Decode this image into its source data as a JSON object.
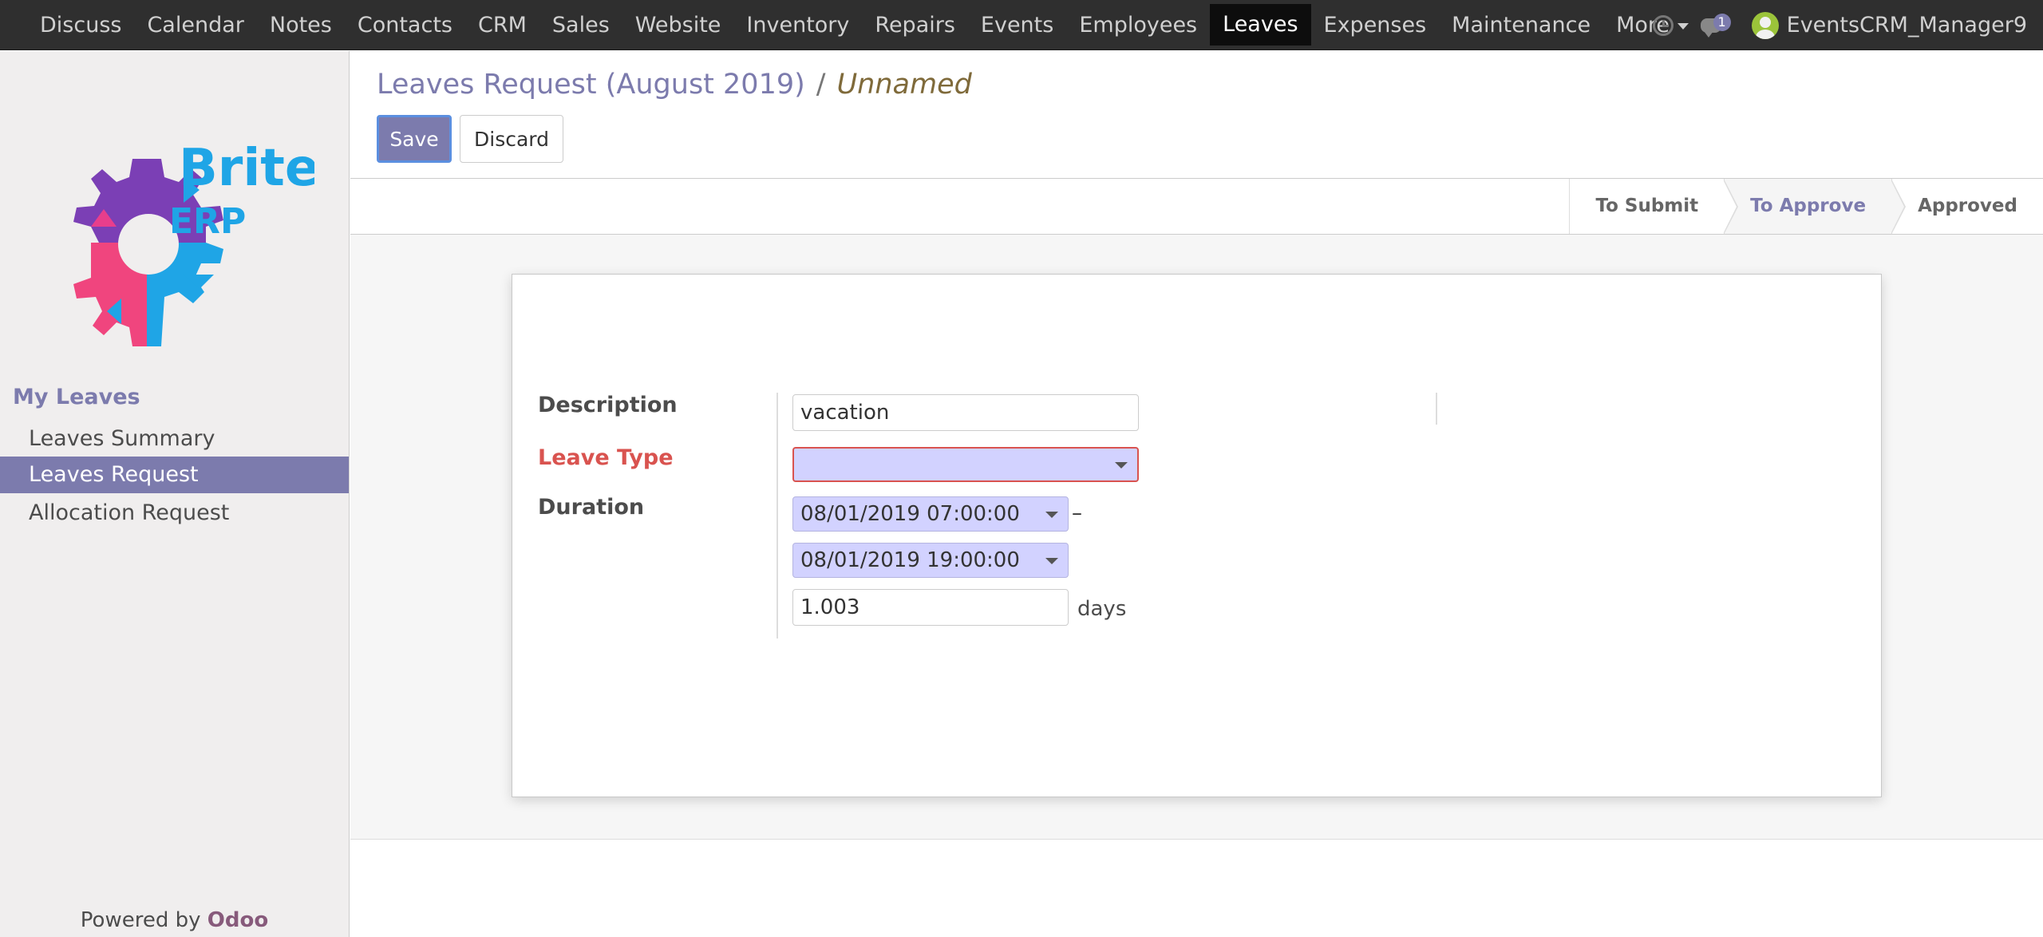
{
  "navbar": {
    "menu": [
      {
        "label": "Discuss",
        "active": false
      },
      {
        "label": "Calendar",
        "active": false
      },
      {
        "label": "Notes",
        "active": false
      },
      {
        "label": "Contacts",
        "active": false
      },
      {
        "label": "CRM",
        "active": false
      },
      {
        "label": "Sales",
        "active": false
      },
      {
        "label": "Website",
        "active": false
      },
      {
        "label": "Inventory",
        "active": false
      },
      {
        "label": "Repairs",
        "active": false
      },
      {
        "label": "Events",
        "active": false
      },
      {
        "label": "Employees",
        "active": false
      },
      {
        "label": "Leaves",
        "active": true
      },
      {
        "label": "Expenses",
        "active": false
      },
      {
        "label": "Maintenance",
        "active": false
      }
    ],
    "more_label": "More",
    "messages_count": "1",
    "user_name": "EventsCRM_Manager9"
  },
  "sidebar": {
    "logo_text_top": "Brite",
    "logo_text_bottom": "ERP",
    "section_title": "My Leaves",
    "items": [
      {
        "label": "Leaves Summary",
        "active": false
      },
      {
        "label": "Leaves Request",
        "active": true
      },
      {
        "label": "Allocation Request",
        "active": false
      }
    ],
    "powered_by": "Powered by",
    "powered_brand": "Odoo"
  },
  "control_panel": {
    "breadcrumb_parent": "Leaves Request (August 2019)",
    "breadcrumb_separator": "/",
    "breadcrumb_current": "Unnamed",
    "save_label": "Save",
    "discard_label": "Discard"
  },
  "statusbar": {
    "stages": [
      {
        "label": "To Submit",
        "current": false
      },
      {
        "label": "To Approve",
        "current": true
      },
      {
        "label": "Approved",
        "current": false
      }
    ]
  },
  "form": {
    "description_label": "Description",
    "description_value": "vacation",
    "leave_type_label": "Leave Type",
    "leave_type_value": "",
    "duration_label": "Duration",
    "date_from": "08/01/2019 07:00:00",
    "date_separator": "–",
    "date_to": "08/01/2019 19:00:00",
    "number_of_days": "1.003",
    "days_unit": "days"
  },
  "colors": {
    "brand": "#7c7bad",
    "navbar_bg": "#2f2f2f",
    "required": "#d9534f",
    "field_highlight": "#d2d2ff"
  }
}
